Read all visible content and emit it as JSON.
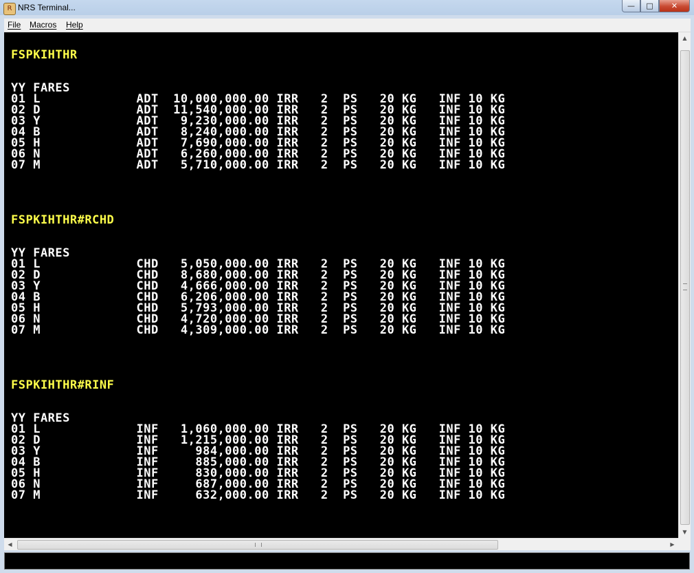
{
  "window": {
    "title": "NRS Terminal..."
  },
  "menu": [
    "File",
    "Macros",
    "Help"
  ],
  "sections": [
    {
      "command": "FSPKIHTHR",
      "header": "YY FARES",
      "rows": [
        "01 L             ADT  10,000,000.00 IRR   2  PS   20 KG   INF 10 KG",
        "02 D             ADT  11,540,000.00 IRR   2  PS   20 KG   INF 10 KG",
        "03 Y             ADT   9,230,000.00 IRR   2  PS   20 KG   INF 10 KG",
        "04 B             ADT   8,240,000.00 IRR   2  PS   20 KG   INF 10 KG",
        "05 H             ADT   7,690,000.00 IRR   2  PS   20 KG   INF 10 KG",
        "06 N             ADT   6,260,000.00 IRR   2  PS   20 KG   INF 10 KG",
        "07 M             ADT   5,710,000.00 IRR   2  PS   20 KG   INF 10 KG"
      ]
    },
    {
      "command": "FSPKIHTHR#RCHD",
      "header": "YY FARES",
      "rows": [
        "01 L             CHD   5,050,000.00 IRR   2  PS   20 KG   INF 10 KG",
        "02 D             CHD   8,680,000.00 IRR   2  PS   20 KG   INF 10 KG",
        "03 Y             CHD   4,666,000.00 IRR   2  PS   20 KG   INF 10 KG",
        "04 B             CHD   6,206,000.00 IRR   2  PS   20 KG   INF 10 KG",
        "05 H             CHD   5,793,000.00 IRR   2  PS   20 KG   INF 10 KG",
        "06 N             CHD   4,720,000.00 IRR   2  PS   20 KG   INF 10 KG",
        "07 M             CHD   4,309,000.00 IRR   2  PS   20 KG   INF 10 KG"
      ]
    },
    {
      "command": "FSPKIHTHR#RINF",
      "header": "YY FARES",
      "rows": [
        "01 L             INF   1,060,000.00 IRR   2  PS   20 KG   INF 10 KG",
        "02 D             INF   1,215,000.00 IRR   2  PS   20 KG   INF 10 KG",
        "03 Y             INF     984,000.00 IRR   2  PS   20 KG   INF 10 KG",
        "04 B             INF     885,000.00 IRR   2  PS   20 KG   INF 10 KG",
        "05 H             INF     830,000.00 IRR   2  PS   20 KG   INF 10 KG",
        "06 N             INF     687,000.00 IRR   2  PS   20 KG   INF 10 KG",
        "07 M             INF     632,000.00 IRR   2  PS   20 KG   INF 10 KG"
      ]
    }
  ],
  "command_input": {
    "value": ""
  },
  "colors": {
    "terminal_bg": "#000000",
    "text": "#ffffff",
    "command": "#ffff4a"
  }
}
